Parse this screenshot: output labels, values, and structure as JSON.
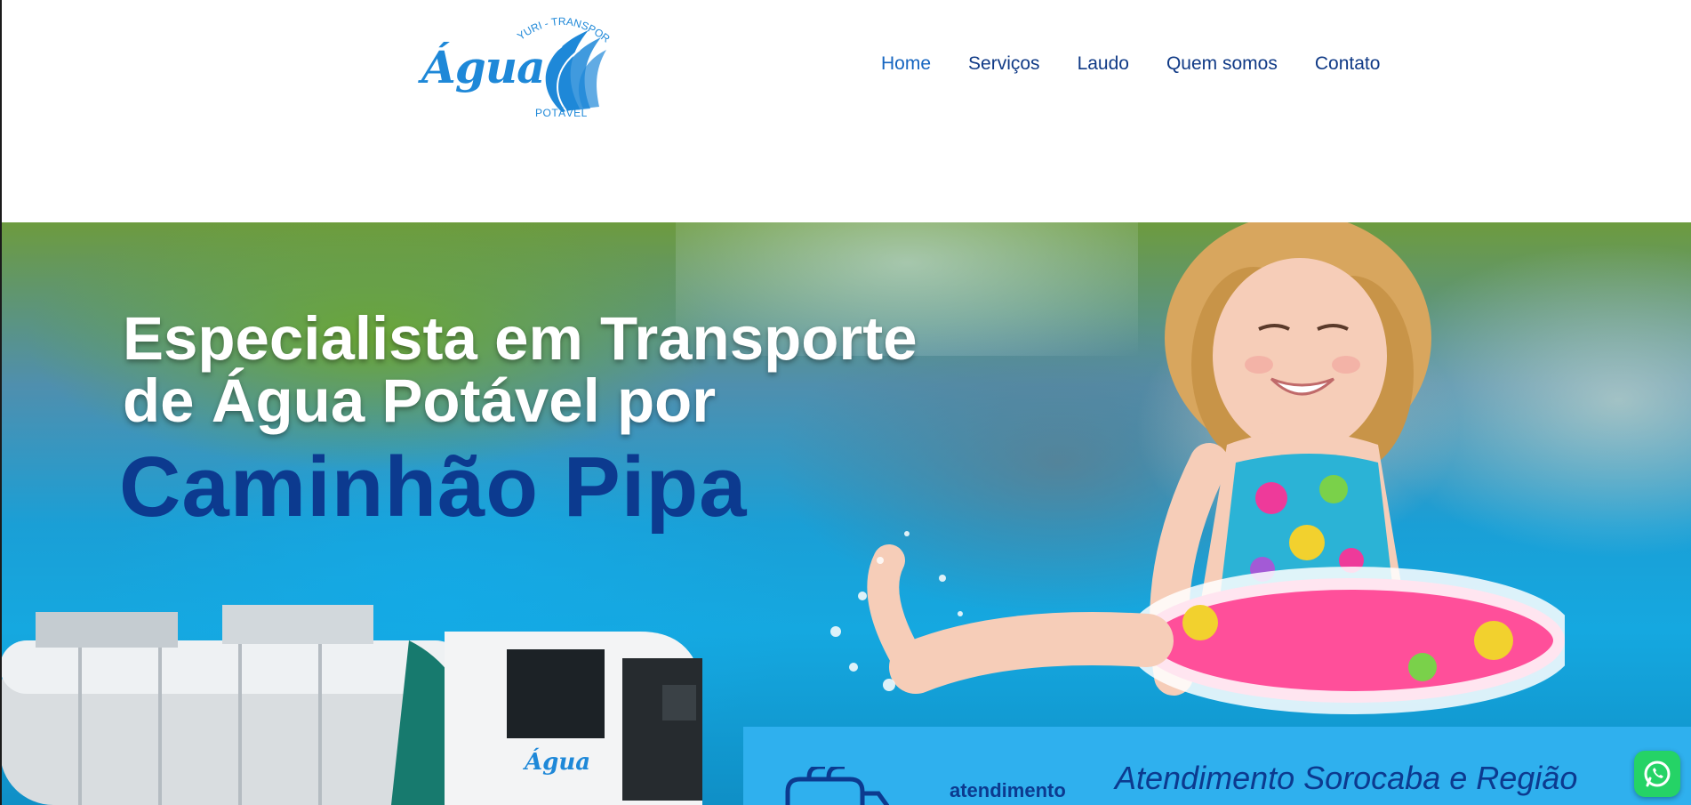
{
  "brand": {
    "logo_word": "Água",
    "logo_top": "YURI - TRANSPORTES",
    "logo_bottom": "POTÁVEL",
    "color": "#1e88d8"
  },
  "nav": {
    "items": [
      {
        "label": "Home",
        "active": true
      },
      {
        "label": "Serviços",
        "active": false
      },
      {
        "label": "Laudo",
        "active": false
      },
      {
        "label": "Quem somos",
        "active": false
      },
      {
        "label": "Contato",
        "active": false
      }
    ],
    "color": "#103a86"
  },
  "hero": {
    "headline_line1": "Especialista em Transporte",
    "headline_line2": "de Água Potável por",
    "headline_accent": "Caminhão Pipa",
    "accent_color": "#0c3a8f"
  },
  "band": {
    "label": "atendimento",
    "title": "Atendimento Sorocaba e Região",
    "background": "#2fb0ee"
  },
  "truck": {
    "logo_word": "Água"
  },
  "whatsapp": {
    "icon": "whatsapp-icon",
    "color": "#25d366"
  }
}
